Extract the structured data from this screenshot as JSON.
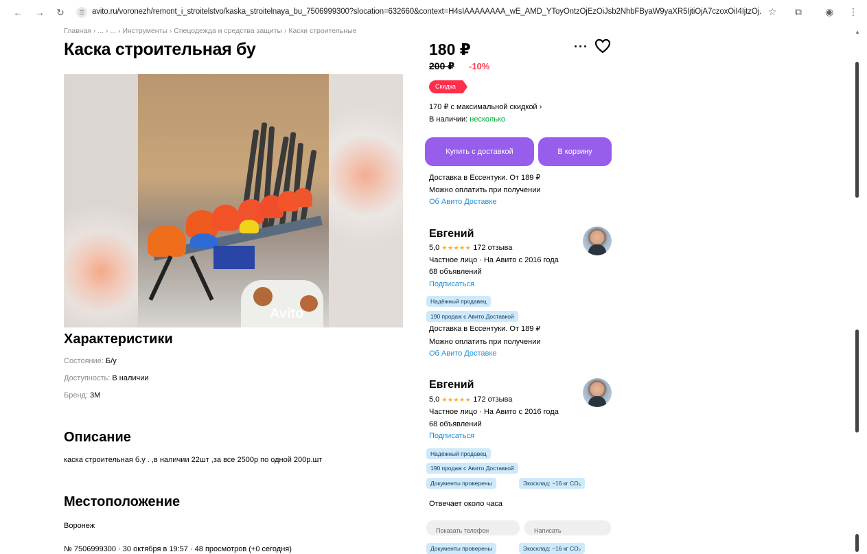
{
  "browser": {
    "url": "avito.ru/voronezh/remont_i_stroitelstvo/kaska_stroitelnaya_bu_7506999300?slocation=632660&context=H4sIAAAAAAAA_wE_AMD_YToyOntzOjEzOiJsb2NhbFByaW9yaXR5IjtiOjA7czoxOiI4IjtzOj..."
  },
  "breadcrumb": "Главная › ... › ... › Инструменты › Спецодежда и средства защиты › Каски строительные",
  "listing": {
    "title": "Каска строительная бу",
    "photo_watermark": "Avito"
  },
  "characteristics": {
    "heading": "Характеристики",
    "items": [
      {
        "key": "Состояние: ",
        "value": "Б/у"
      },
      {
        "key": "Доступность: ",
        "value": "В наличии"
      },
      {
        "key": "Бренд: ",
        "value": "3М"
      }
    ]
  },
  "description": {
    "heading": "Описание",
    "text": "каска строительная б.у . ,в наличии 22шт ,за все 2500р по одной 200р.шт"
  },
  "location": {
    "heading": "Местоположение",
    "city": "Воронеж",
    "meta": "№ 7506999300 · 30 октября в 19:57 · 48 просмотров (+0 сегодня)"
  },
  "offer": {
    "price": "180 ₽",
    "old_price": "200 ₽",
    "discount": "-10%",
    "sale_badge": "Скидка",
    "max_discount": "170 ₽ с максимальной скидкой ›",
    "stock_label": "В наличии: ",
    "stock_value": "несколько",
    "buy_button": "Купить с доставкой",
    "cart_button": "В корзину",
    "delivery": "Доставка в Ессентуки. От 189 ₽",
    "payment": "Можно оплатить при получении",
    "delivery_link": "Об Авито Доставке"
  },
  "seller": {
    "name": "Евгений",
    "rating": "5,0",
    "stars": "★★★★★",
    "reviews": "172 отзыва",
    "type": "Частное лицо · На Авито с 2016 года",
    "ads": "68 объявлений",
    "subscribe": "Подписаться",
    "tags": [
      "Надёжный продавец",
      "190 продаж с Авито Доставкой"
    ],
    "tags_extra": [
      "Документы проверены",
      "Экосклад: ~16 кг CO₂"
    ],
    "response": "Отвечает около часа",
    "ghost_buttons": [
      "Показать телефон",
      "Написать"
    ]
  },
  "colors": {
    "accent": "#965eeb",
    "sale": "#ff2e4d",
    "link": "#1e90d6",
    "in_stock": "#00aa3c"
  }
}
